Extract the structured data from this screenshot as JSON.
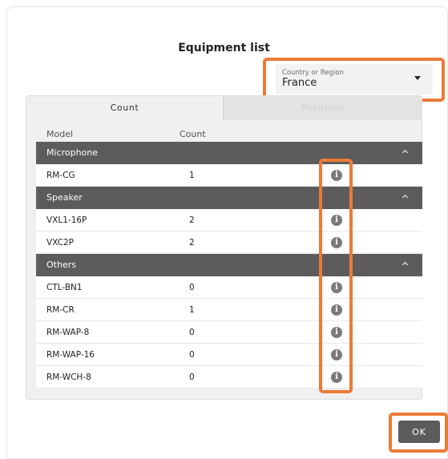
{
  "dialog": {
    "title": "Equipment list"
  },
  "region": {
    "label": "Country or Region",
    "value": "France"
  },
  "tabs": [
    {
      "label": "Count",
      "active": true
    },
    {
      "label": "Positions",
      "active": false
    }
  ],
  "columns": {
    "model": "Model",
    "count": "Count"
  },
  "groups": [
    {
      "name": "Microphone",
      "items": [
        {
          "model": "RM-CG",
          "count": "1"
        }
      ]
    },
    {
      "name": "Speaker",
      "items": [
        {
          "model": "VXL1-16P",
          "count": "2"
        },
        {
          "model": "VXC2P",
          "count": "2"
        }
      ]
    },
    {
      "name": "Others",
      "items": [
        {
          "model": "CTL-BN1",
          "count": "0"
        },
        {
          "model": "RM-CR",
          "count": "1"
        },
        {
          "model": "RM-WAP-8",
          "count": "0"
        },
        {
          "model": "RM-WAP-16",
          "count": "0"
        },
        {
          "model": "RM-WCH-8",
          "count": "0"
        }
      ]
    }
  ],
  "icons": {
    "info": "info-icon",
    "collapse": "chevron-up-icon",
    "dropdown": "caret-down-icon"
  },
  "colors": {
    "highlight": "#ec7a37",
    "group_header": "#5c5c5c",
    "ok_button": "#5c5c5c"
  },
  "actions": {
    "ok_label": "OK"
  }
}
